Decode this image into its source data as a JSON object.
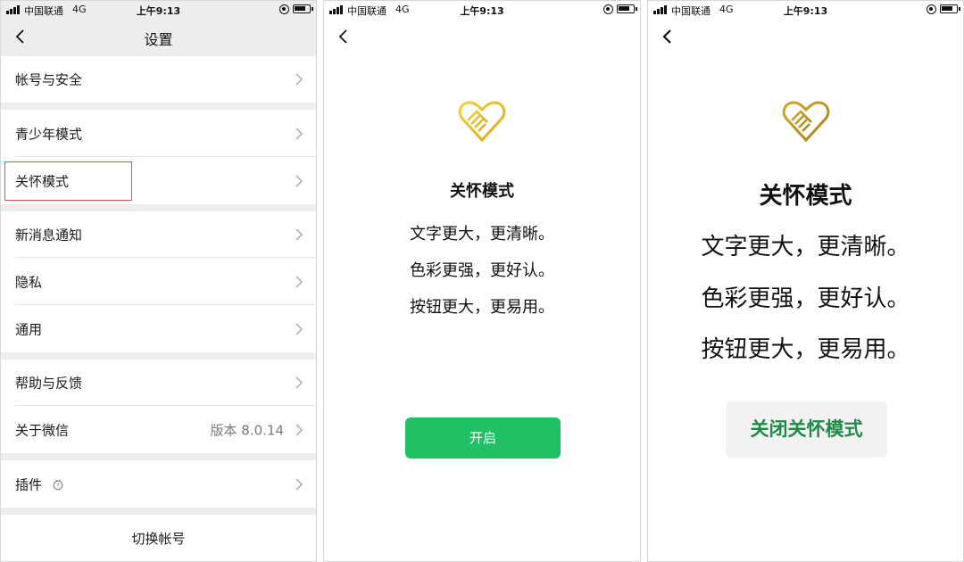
{
  "status_bar": {
    "carrier": "中国联通",
    "network": "4G",
    "time": "上午9:13"
  },
  "settings": {
    "title": "设置",
    "items": [
      {
        "label": "帐号与安全"
      },
      {
        "label": "青少年模式"
      },
      {
        "label": "关怀模式",
        "highlighted": true
      },
      {
        "label": "新消息通知"
      },
      {
        "label": "隐私"
      },
      {
        "label": "通用"
      },
      {
        "label": "帮助与反馈"
      },
      {
        "label": "关于微信",
        "value": "版本 8.0.14"
      },
      {
        "label": "插件"
      }
    ],
    "switch_account": "切换帐号"
  },
  "care_mode": {
    "title": "关怀模式",
    "lines": [
      "文字更大，更清晰。",
      "色彩更强，更好认。",
      "按钮更大，更易用。"
    ],
    "enable_button": "开启",
    "close_button": "关闭关怀模式"
  },
  "colors": {
    "accent_green": "#22c064",
    "close_text_green": "#1f8a47",
    "icon_gold": "#e1b82c",
    "icon_gold_dark": "#b58a1b",
    "highlight_red": "#d9534f"
  },
  "icons": [
    "signal-icon",
    "back-arrow-icon",
    "chevron-right-icon",
    "plugin-icon",
    "care-heart-icon",
    "battery-icon",
    "orientation-lock-icon"
  ]
}
